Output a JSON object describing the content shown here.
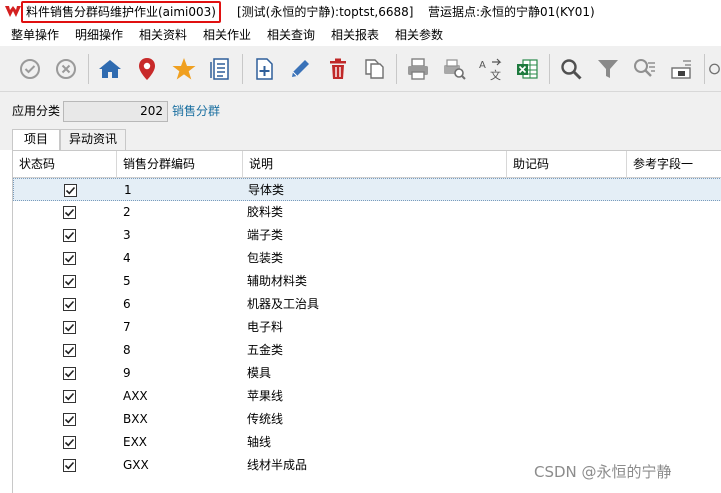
{
  "window": {
    "title": "料件销售分群码维护作业(aimi003)",
    "environment": "[测试(永恒的宁静):toptst,6688]",
    "site": "营运据点:永恒的宁静01(KY01)"
  },
  "menu": [
    "整单操作",
    "明细操作",
    "相关资料",
    "相关作业",
    "相关查询",
    "相关报表",
    "相关参数"
  ],
  "toolbar": [
    "confirm-icon",
    "cancel-icon",
    "home-icon",
    "location-pin-icon",
    "favorite-star-icon",
    "document-list-icon",
    "add-icon",
    "edit-pencil-icon",
    "delete-trash-icon",
    "copy-icon",
    "print-icon",
    "print-preview-icon",
    "translate-icon",
    "excel-export-icon",
    "search-icon",
    "filter-icon",
    "advanced-search-icon",
    "sort-icon",
    "refresh-icon"
  ],
  "category": {
    "label": "应用分类",
    "value": "202",
    "description": "销售分群"
  },
  "tabs": [
    "项目",
    "异动资讯"
  ],
  "grid": {
    "columns": [
      "状态码",
      "销售分群编码",
      "说明",
      "助记码",
      "参考字段一"
    ],
    "rows": [
      {
        "checked": true,
        "code": "1",
        "desc": "导体类",
        "selected": true
      },
      {
        "checked": true,
        "code": "2",
        "desc": "胶料类"
      },
      {
        "checked": true,
        "code": "3",
        "desc": "端子类"
      },
      {
        "checked": true,
        "code": "4",
        "desc": "包装类"
      },
      {
        "checked": true,
        "code": "5",
        "desc": "辅助材料类"
      },
      {
        "checked": true,
        "code": "6",
        "desc": "机器及工治具"
      },
      {
        "checked": true,
        "code": "7",
        "desc": "电子料"
      },
      {
        "checked": true,
        "code": "8",
        "desc": "五金类"
      },
      {
        "checked": true,
        "code": "9",
        "desc": "模具"
      },
      {
        "checked": true,
        "code": "AXX",
        "desc": "苹果线"
      },
      {
        "checked": true,
        "code": "BXX",
        "desc": "传统线"
      },
      {
        "checked": true,
        "code": "EXX",
        "desc": "轴线"
      },
      {
        "checked": true,
        "code": "GXX",
        "desc": "线材半成品"
      }
    ]
  },
  "watermark": "CSDN @永恒的宁静",
  "colors": {
    "title_highlight": "#e01010",
    "link_blue": "#1a6fa0",
    "selected_row": "#e4eef6",
    "toolbar_bg": "#f0f0f0"
  }
}
